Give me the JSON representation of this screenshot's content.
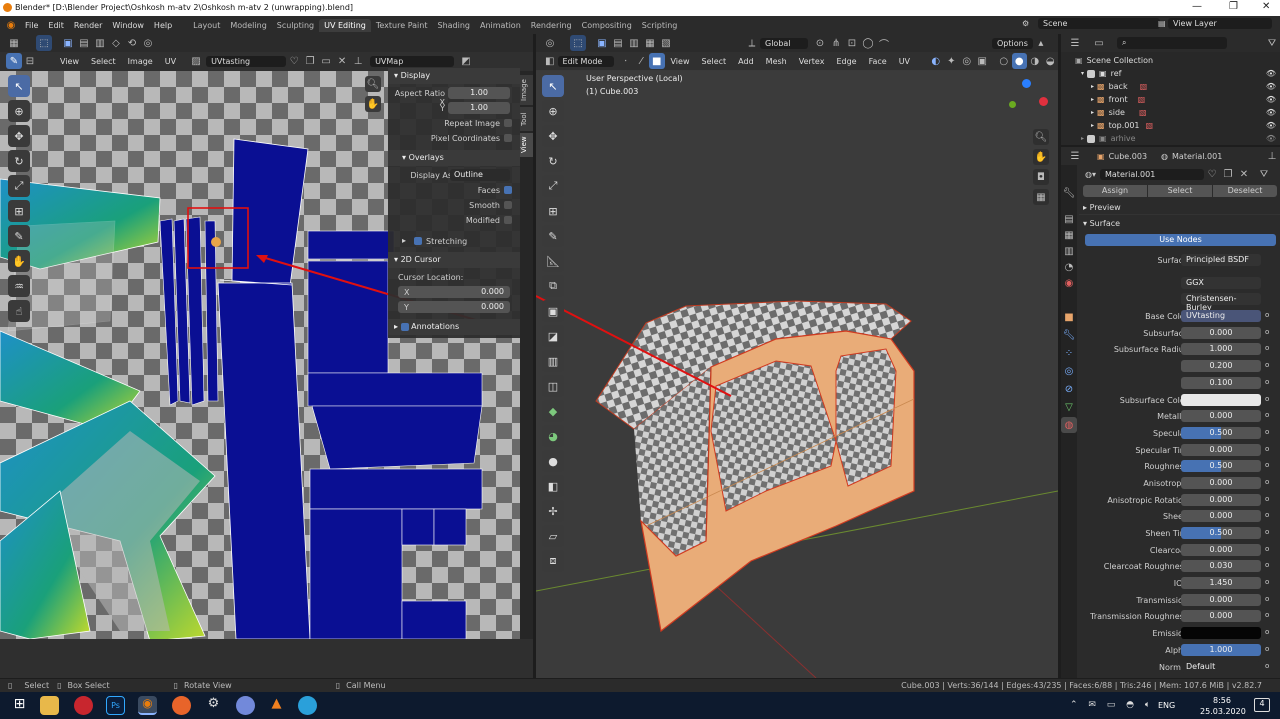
{
  "window": {
    "title": "Blender* [D:\\Blender Project\\Oshkosh m-atv 2\\Oshkosh m-atv 2 (unwrapping).blend]"
  },
  "menu": [
    "File",
    "Edit",
    "Render",
    "Window",
    "Help"
  ],
  "workspaces": [
    "Layout",
    "Modeling",
    "Sculpting",
    "UV Editing",
    "Texture Paint",
    "Shading",
    "Animation",
    "Rendering",
    "Compositing",
    "Scripting"
  ],
  "active_workspace": "UV Editing",
  "scene": "Scene",
  "view_layer": "View Layer",
  "uv_editor": {
    "menus": [
      "View",
      "Select",
      "Image",
      "UV"
    ],
    "image": "UVtasting",
    "uvmap": "UVMap",
    "tabs": [
      "Image",
      "Tool",
      "View"
    ]
  },
  "npanel": {
    "display_title": "Display",
    "aspect_label": "Aspect Ratio X",
    "aspect_x": "1.00",
    "aspect_y_label": "Y",
    "aspect_y": "1.00",
    "repeat_image": "Repeat Image",
    "pixel_coords": "Pixel Coordinates",
    "overlays_title": "Overlays",
    "display_as_label": "Display As",
    "display_as": "Outline",
    "faces": "Faces",
    "smooth": "Smooth",
    "modified": "Modified",
    "stretching": "Stretching",
    "cursor_title": "2D Cursor",
    "cursor_location": "Cursor Location:",
    "cx_label": "X",
    "cx": "0.000",
    "cy_label": "Y",
    "cy": "0.000",
    "annotations": "Annotations"
  },
  "viewport": {
    "mode": "Edit Mode",
    "menus": [
      "View",
      "Select",
      "Add",
      "Mesh",
      "Vertex",
      "Edge",
      "Face",
      "UV"
    ],
    "transform": "Global",
    "options": "Options",
    "info1": "User Perspective (Local)",
    "info2": "(1) Cube.003"
  },
  "outliner": {
    "root": "Scene Collection",
    "items": [
      {
        "name": "ref"
      },
      {
        "name": "back"
      },
      {
        "name": "front"
      },
      {
        "name": "side"
      },
      {
        "name": "top.001"
      },
      {
        "name": "arhive"
      }
    ]
  },
  "properties": {
    "object": "Cube.003",
    "material_tab": "Material.001",
    "material": "Material.001",
    "assign": "Assign",
    "select": "Select",
    "deselect": "Deselect",
    "preview": "Preview",
    "surface_section": "Surface",
    "use_nodes": "Use Nodes",
    "surface_label": "Surface",
    "surface_value": "Principled BSDF",
    "distribution": "GGX",
    "subsurface_method": "Christensen-Burley",
    "rows": [
      {
        "label": "Base Color",
        "value": "UVtasting",
        "kind": "tex"
      },
      {
        "label": "Subsurface",
        "value": "0.000",
        "kind": "num"
      },
      {
        "label": "Subsurface Radius",
        "value": "1.000",
        "kind": "num"
      },
      {
        "label": "",
        "value": "0.200",
        "kind": "num"
      },
      {
        "label": "",
        "value": "0.100",
        "kind": "num"
      },
      {
        "label": "Subsurface Color",
        "value": "",
        "kind": "white"
      },
      {
        "label": "Metallic",
        "value": "0.000",
        "kind": "num"
      },
      {
        "label": "Specular",
        "value": "0.500",
        "kind": "fill"
      },
      {
        "label": "Specular Tint",
        "value": "0.000",
        "kind": "num"
      },
      {
        "label": "Roughness",
        "value": "0.500",
        "kind": "fill"
      },
      {
        "label": "Anisotropic",
        "value": "0.000",
        "kind": "num"
      },
      {
        "label": "Anisotropic Rotation",
        "value": "0.000",
        "kind": "num"
      },
      {
        "label": "Sheen",
        "value": "0.000",
        "kind": "num"
      },
      {
        "label": "Sheen Tint",
        "value": "0.500",
        "kind": "fill"
      },
      {
        "label": "Clearcoat",
        "value": "0.000",
        "kind": "num"
      },
      {
        "label": "Clearcoat Roughness",
        "value": "0.030",
        "kind": "num"
      },
      {
        "label": "IOR",
        "value": "1.450",
        "kind": "num"
      },
      {
        "label": "Transmission",
        "value": "0.000",
        "kind": "num"
      },
      {
        "label": "Transmission Roughness",
        "value": "0.000",
        "kind": "num"
      },
      {
        "label": "Emission",
        "value": "",
        "kind": "black"
      },
      {
        "label": "Alpha",
        "value": "1.000",
        "kind": "full"
      },
      {
        "label": "Normal",
        "value": "Default",
        "kind": "plain"
      }
    ]
  },
  "status": {
    "select": "Select",
    "box_select": "Box Select",
    "rotate_view": "Rotate View",
    "call_menu": "Call Menu",
    "stats": "Cube.003 | Verts:36/144 | Edges:43/235 | Faces:6/88 | Tris:246 | Mem: 107.6 MiB | v2.82.7"
  },
  "tray": {
    "lang": "ENG",
    "time": "8:56",
    "date": "25.03.2020",
    "notif": "4"
  },
  "colors": {
    "accent": "#4772b3",
    "uv_island": "#0a0f93",
    "selection_orange": "#e8a56b",
    "annotation_red": "#e01010"
  }
}
